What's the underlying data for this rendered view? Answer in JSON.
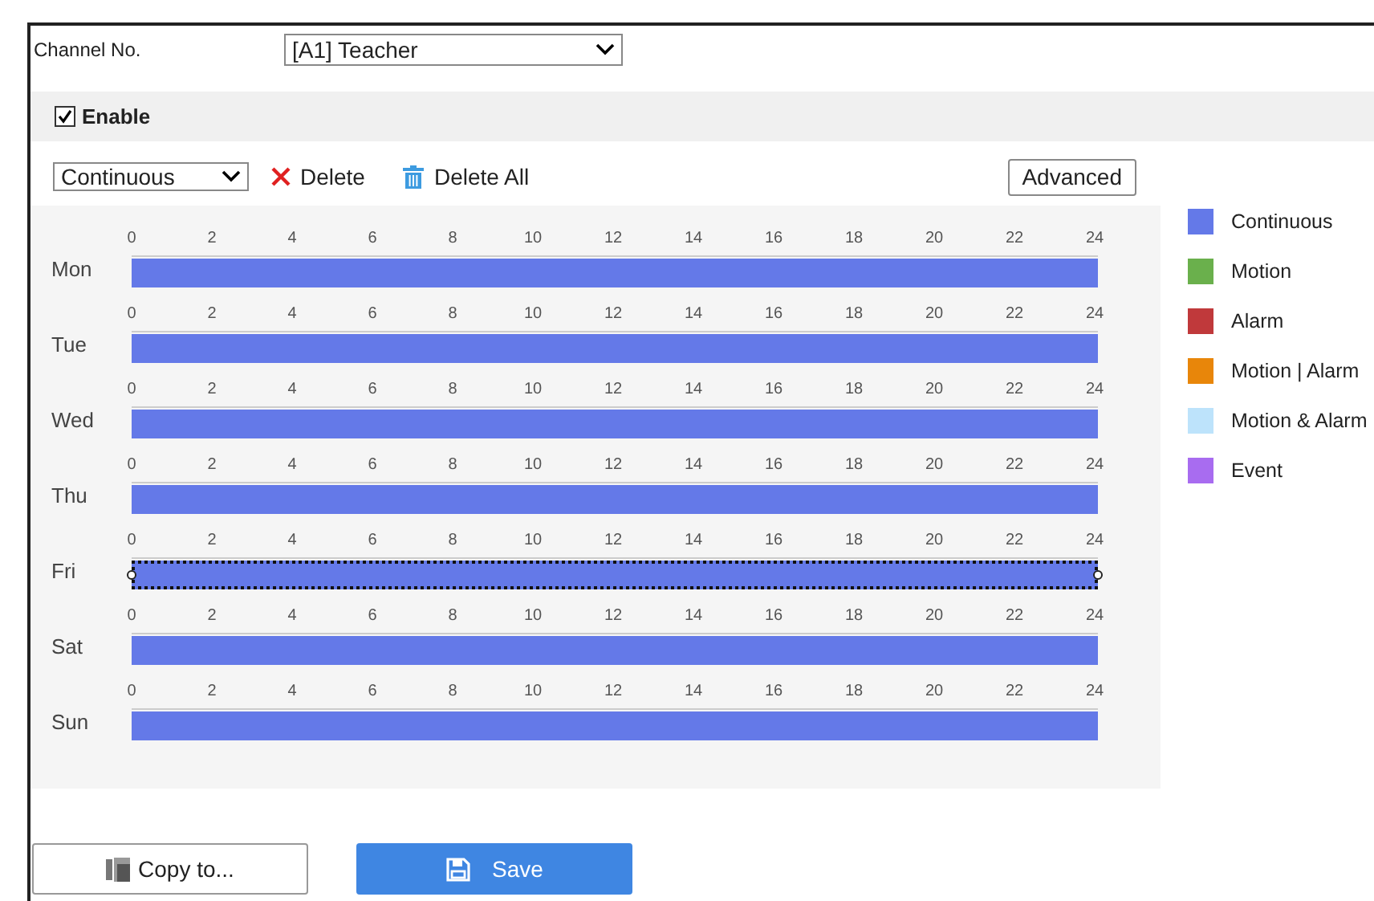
{
  "channel": {
    "label": "Channel No.",
    "value": "[A1] Teacher"
  },
  "enable": {
    "label": "Enable",
    "checked": true
  },
  "toolbar": {
    "type_select": "Continuous",
    "delete": "Delete",
    "delete_all": "Delete All",
    "advanced": "Advanced"
  },
  "days": [
    {
      "label": "Mon",
      "selected": false,
      "level": 1,
      "color": "#6479e8",
      "hours": [
        "0",
        "2",
        "4",
        "6",
        "8",
        "10",
        "12",
        "14",
        "16",
        "18",
        "20",
        "22",
        "24"
      ]
    },
    {
      "label": "Tue",
      "selected": false,
      "level": 1,
      "color": "#6479e8",
      "hours": [
        "0",
        "2",
        "4",
        "6",
        "8",
        "10",
        "12",
        "14",
        "16",
        "18",
        "20",
        "22",
        "24"
      ]
    },
    {
      "label": "Wed",
      "selected": false,
      "level": 1,
      "color": "#6479e8",
      "hours": [
        "0",
        "2",
        "4",
        "6",
        "8",
        "10",
        "12",
        "14",
        "16",
        "18",
        "20",
        "22",
        "24"
      ]
    },
    {
      "label": "Thu",
      "selected": false,
      "level": 1,
      "color": "#6479e8",
      "hours": [
        "0",
        "2",
        "4",
        "6",
        "8",
        "10",
        "12",
        "14",
        "16",
        "18",
        "20",
        "22",
        "24"
      ]
    },
    {
      "label": "Fri",
      "selected": true,
      "level": 1,
      "color": "#6479e8",
      "hours": [
        "0",
        "2",
        "4",
        "6",
        "8",
        "10",
        "12",
        "14",
        "16",
        "18",
        "20",
        "22",
        "24"
      ]
    },
    {
      "label": "Sat",
      "selected": false,
      "level": 1,
      "color": "#6479e8",
      "hours": [
        "0",
        "2",
        "4",
        "6",
        "8",
        "10",
        "12",
        "14",
        "16",
        "18",
        "20",
        "22",
        "24"
      ]
    },
    {
      "label": "Sun",
      "selected": false,
      "level": 1,
      "color": "#6479e8",
      "hours": [
        "0",
        "2",
        "4",
        "6",
        "8",
        "10",
        "12",
        "14",
        "16",
        "18",
        "20",
        "22",
        "24"
      ]
    }
  ],
  "legend": [
    {
      "label": "Continuous",
      "color": "#6479e8"
    },
    {
      "label": "Motion",
      "color": "#6ab04c"
    },
    {
      "label": "Alarm",
      "color": "#c0393b"
    },
    {
      "label": "Motion | Alarm",
      "color": "#e8860a"
    },
    {
      "label": "Motion & Alarm",
      "color": "#bde3fb"
    },
    {
      "label": "Event",
      "color": "#a86cf0"
    }
  ],
  "buttons": {
    "copy": "Copy to...",
    "save": "Save"
  }
}
